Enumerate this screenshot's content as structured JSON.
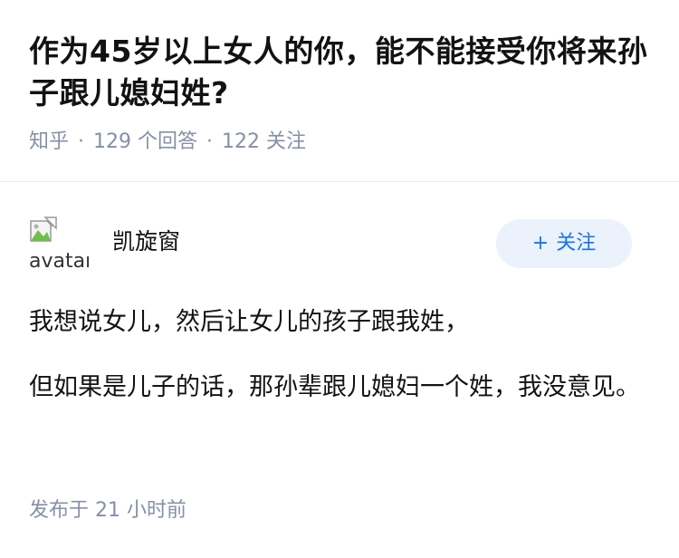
{
  "question": {
    "title": "作为45岁以上女人的你，能不能接受你将来孙子跟儿媳妇姓?",
    "source": "知乎",
    "separator": "·",
    "answers_count": "129 个回答",
    "followers_count": "122 关注"
  },
  "answer": {
    "author": {
      "name": "凯旋窗",
      "avatar_alt": "avatar"
    },
    "follow_button": {
      "icon": "+",
      "label": "关注"
    },
    "paragraphs": [
      "我想说女儿，然后让女儿的孩子跟我姓，",
      "但如果是儿子的话，那孙辈跟儿媳妇一个姓，我没意见。"
    ],
    "published": "发布于 21 小时前"
  },
  "colors": {
    "text": "#121212",
    "meta": "#8590a6",
    "accent": "#1772f6",
    "button_bg": "#ebf2fc"
  }
}
